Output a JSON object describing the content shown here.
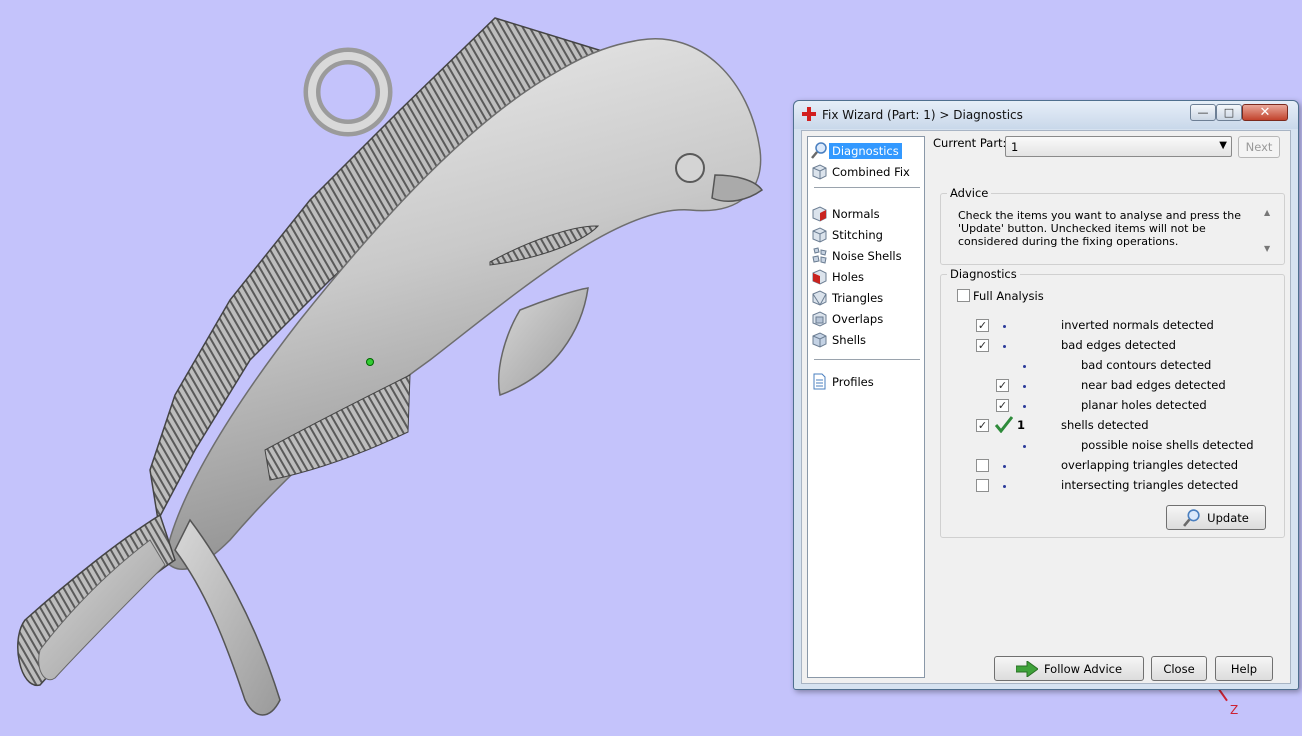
{
  "viewport": {
    "axis_label": "Z",
    "background": "#c4c3fb"
  },
  "dialog": {
    "title": "Fix Wizard (Part: 1) > Diagnostics",
    "window_buttons": {
      "minimize": "—",
      "maximize": "□",
      "close": "✕"
    }
  },
  "nav": {
    "top_items": [
      {
        "label": "Diagnostics",
        "icon": "magnifier-icon",
        "selected": true
      },
      {
        "label": "Combined Fix",
        "icon": "cube-icon"
      }
    ],
    "fix_items": [
      {
        "label": "Normals",
        "icon": "normals-cube-icon"
      },
      {
        "label": "Stitching",
        "icon": "stitching-cube-icon"
      },
      {
        "label": "Noise Shells",
        "icon": "noise-shells-icon"
      },
      {
        "label": "Holes",
        "icon": "holes-cube-icon"
      },
      {
        "label": "Triangles",
        "icon": "triangles-cube-icon"
      },
      {
        "label": "Overlaps",
        "icon": "overlaps-cube-icon"
      },
      {
        "label": "Shells",
        "icon": "shells-cube-icon"
      }
    ],
    "bottom_items": [
      {
        "label": "Profiles",
        "icon": "document-icon"
      }
    ]
  },
  "current_part": {
    "label": "Current Part:",
    "value": "1"
  },
  "buttons": {
    "next": "Next",
    "update": "Update",
    "follow_advice": "Follow Advice",
    "close": "Close",
    "help": "Help"
  },
  "advice": {
    "legend": "Advice",
    "text": "Check the items you want to analyse and press the 'Update' button. Unchecked items will not be considered during the fixing operations."
  },
  "diagnostics": {
    "legend": "Diagnostics",
    "full_analysis": {
      "label": "Full Analysis",
      "checked": false
    },
    "rows": [
      {
        "label": "inverted normals detected",
        "checked": true,
        "indent": 0,
        "status": "bullet"
      },
      {
        "label": "bad edges detected",
        "checked": true,
        "indent": 0,
        "status": "bullet"
      },
      {
        "label": "bad contours detected",
        "checked": null,
        "indent": 1,
        "status": "bullet"
      },
      {
        "label": "near bad edges detected",
        "checked": true,
        "indent": 1,
        "status": "bullet"
      },
      {
        "label": "planar holes detected",
        "checked": true,
        "indent": 1,
        "status": "bullet"
      },
      {
        "label": "shells detected",
        "checked": true,
        "indent": 0,
        "status": "ok",
        "count": "1"
      },
      {
        "label": "possible noise shells detected",
        "checked": null,
        "indent": 1,
        "status": "bullet"
      },
      {
        "label": "overlapping triangles detected",
        "checked": false,
        "indent": 0,
        "status": "bullet"
      },
      {
        "label": "intersecting triangles detected",
        "checked": false,
        "indent": 0,
        "status": "bullet"
      }
    ]
  },
  "colors": {
    "accent": "#3399ff",
    "ok_check": "#2e8b3a",
    "arrow": "#3fa23a"
  }
}
